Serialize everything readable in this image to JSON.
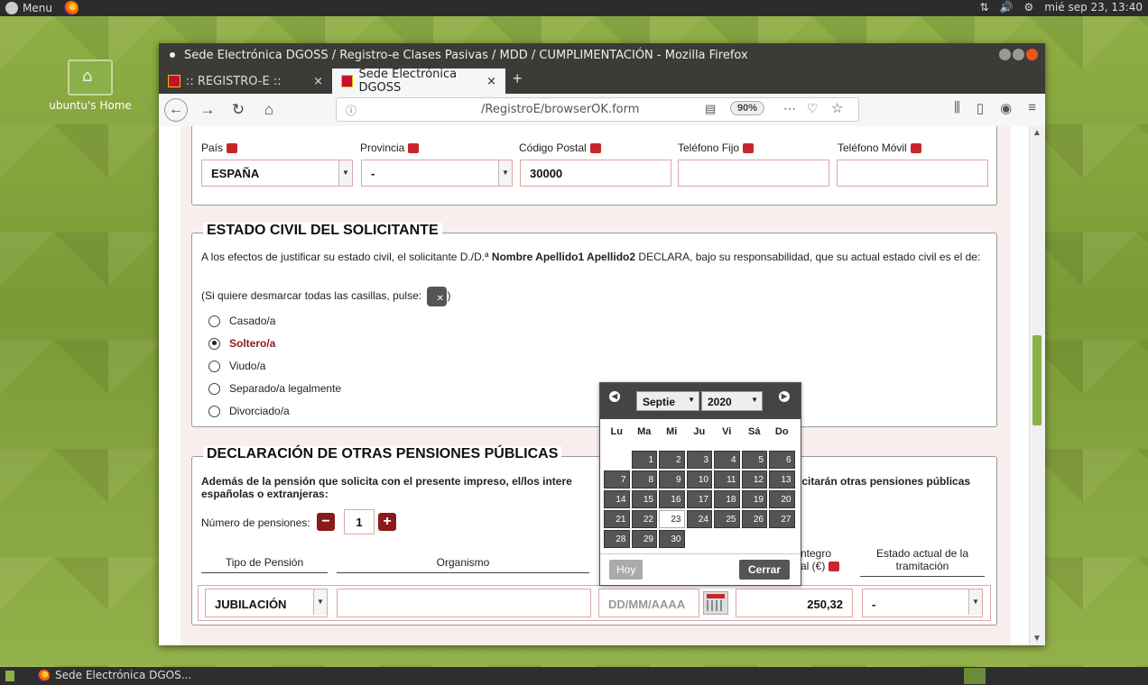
{
  "top_panel": {
    "menu_label": "Menu",
    "clock": "mié sep 23, 13:40"
  },
  "desktop": {
    "home_icon_label": "ubuntu's Home"
  },
  "window": {
    "title": "Sede Electrónica DGOSS / Registro-e Clases Pasivas / MDD / CUMPLIMENTACIÓN - Mozilla Firefox",
    "tabs": [
      {
        "label": ":: REGISTRO-E ::",
        "active": false
      },
      {
        "label": "Sede Electrónica DGOSS",
        "active": true
      }
    ],
    "url": "/RegistroE/browserOK.form",
    "zoom": "90%"
  },
  "address_section": {
    "labels": {
      "pais": "País",
      "provincia": "Provincia",
      "cp": "Código Postal",
      "tel_fijo": "Teléfono Fijo",
      "tel_movil": "Teléfono Móvil"
    },
    "values": {
      "pais": "ESPAÑA",
      "provincia": "-",
      "cp": "30000",
      "tel_fijo": "",
      "tel_movil": ""
    }
  },
  "estado_civil": {
    "legend": "ESTADO CIVIL DEL SOLICITANTE",
    "intro_pre": "A los efectos de justificar su estado civil, el solicitante D./D.ª ",
    "intro_name": "Nombre Apellido1 Apellido2",
    "intro_post": " DECLARA, bajo su responsabilidad, que su actual estado civil es el de:",
    "clear_text_pre": "(Si quiere desmarcar todas las casillas, pulse: ",
    "clear_text_post": ")",
    "options": [
      {
        "label": "Casado/a",
        "checked": false
      },
      {
        "label": "Soltero/a",
        "checked": true
      },
      {
        "label": "Viudo/a",
        "checked": false
      },
      {
        "label": "Separado/a legalmente",
        "checked": false
      },
      {
        "label": "Divorciado/a",
        "checked": false
      }
    ]
  },
  "otras_pensiones": {
    "legend": "DECLARACIÓN DE OTRAS PENSIONES PÚBLICAS",
    "intro_left": "Además de la pensión que solicita con el presente impreso, el/los intere",
    "intro_right": "icitarán otras pensiones públicas",
    "intro_line2": "españolas o extranjeras:",
    "num_label": "Número de pensiones:",
    "num_value": "1",
    "columns": {
      "tipo": "Tipo de Pensión",
      "organismo": "Organismo",
      "integro_1": "ntegro",
      "integro_2": "al (€)",
      "estado_1": "Estado actual de la",
      "estado_2": "tramitación"
    },
    "row": {
      "tipo": "JUBILACIÓN",
      "organismo": "",
      "fecha_placeholder": "DD/MM/AAAA",
      "importe": "250,32",
      "estado": "-"
    }
  },
  "datepicker": {
    "month": "Septie",
    "year": "2020",
    "weekdays": [
      "Lu",
      "Ma",
      "Mi",
      "Ju",
      "Vi",
      "Sá",
      "Do"
    ],
    "leading_blanks": 1,
    "days": [
      "1",
      "2",
      "3",
      "4",
      "5",
      "6",
      "7",
      "8",
      "9",
      "10",
      "11",
      "12",
      "13",
      "14",
      "15",
      "16",
      "17",
      "18",
      "19",
      "20",
      "21",
      "22",
      "23",
      "24",
      "25",
      "26",
      "27",
      "28",
      "29",
      "30"
    ],
    "today": "23",
    "hoy_label": "Hoy",
    "cerrar_label": "Cerrar"
  },
  "taskbar": {
    "task_label": "Sede Electrónica DGOS..."
  }
}
